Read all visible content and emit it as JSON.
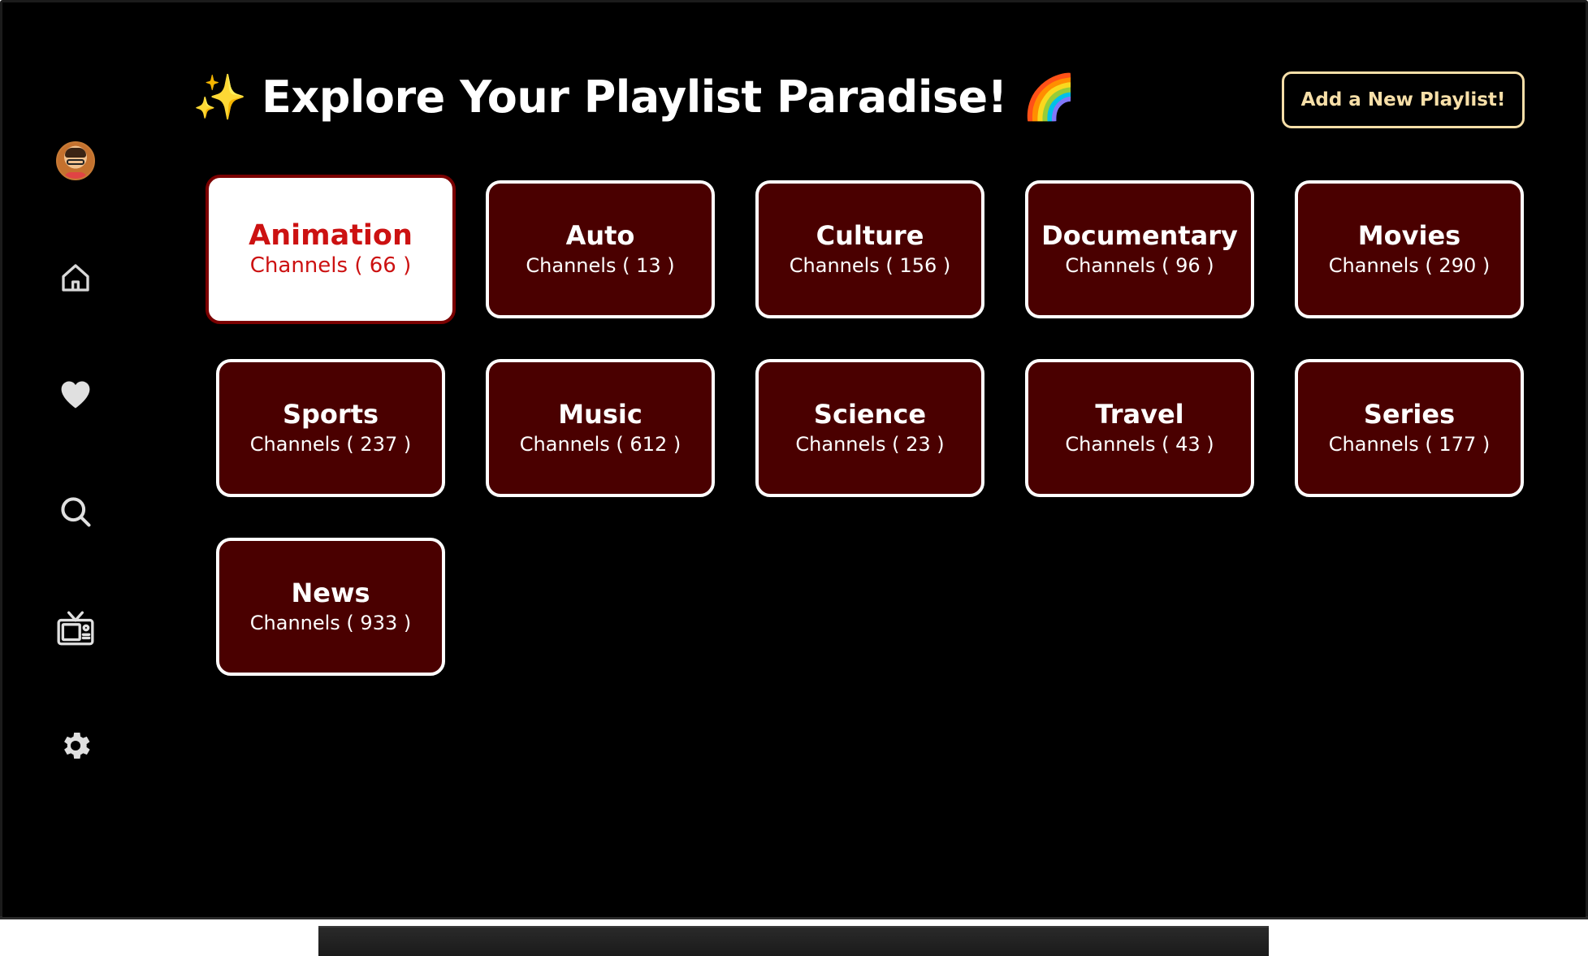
{
  "header": {
    "title": "✨ Explore Your Playlist Paradise! 🌈",
    "add_button_label": "Add a New Playlist!"
  },
  "sidebar": {
    "items": [
      {
        "name": "avatar",
        "icon": "user-avatar-icon"
      },
      {
        "name": "home",
        "icon": "home-icon"
      },
      {
        "name": "favorites",
        "icon": "heart-icon"
      },
      {
        "name": "search",
        "icon": "search-icon"
      },
      {
        "name": "live-tv",
        "icon": "tv-icon"
      },
      {
        "name": "settings",
        "icon": "gear-icon"
      }
    ]
  },
  "playlists": [
    {
      "name": "Animation",
      "count": "Channels ( 66 )",
      "selected": true
    },
    {
      "name": "Auto",
      "count": "Channels ( 13 )"
    },
    {
      "name": "Culture",
      "count": "Channels ( 156 )"
    },
    {
      "name": "Documentary",
      "count": "Channels ( 96 )"
    },
    {
      "name": "Movies",
      "count": "Channels ( 290 )"
    },
    {
      "name": "Sports",
      "count": "Channels ( 237 )"
    },
    {
      "name": "Music",
      "count": "Channels ( 612 )"
    },
    {
      "name": "Science",
      "count": "Channels ( 23 )"
    },
    {
      "name": "Travel",
      "count": "Channels ( 43 )"
    },
    {
      "name": "Series",
      "count": "Channels ( 177 )"
    },
    {
      "name": "News",
      "count": "Channels ( 933 )"
    }
  ],
  "colors": {
    "background": "#000000",
    "card_fill": "#4a0000",
    "card_border": "#ffffff",
    "selected_text": "#cc1111",
    "button_accent": "#f7dfa8"
  }
}
